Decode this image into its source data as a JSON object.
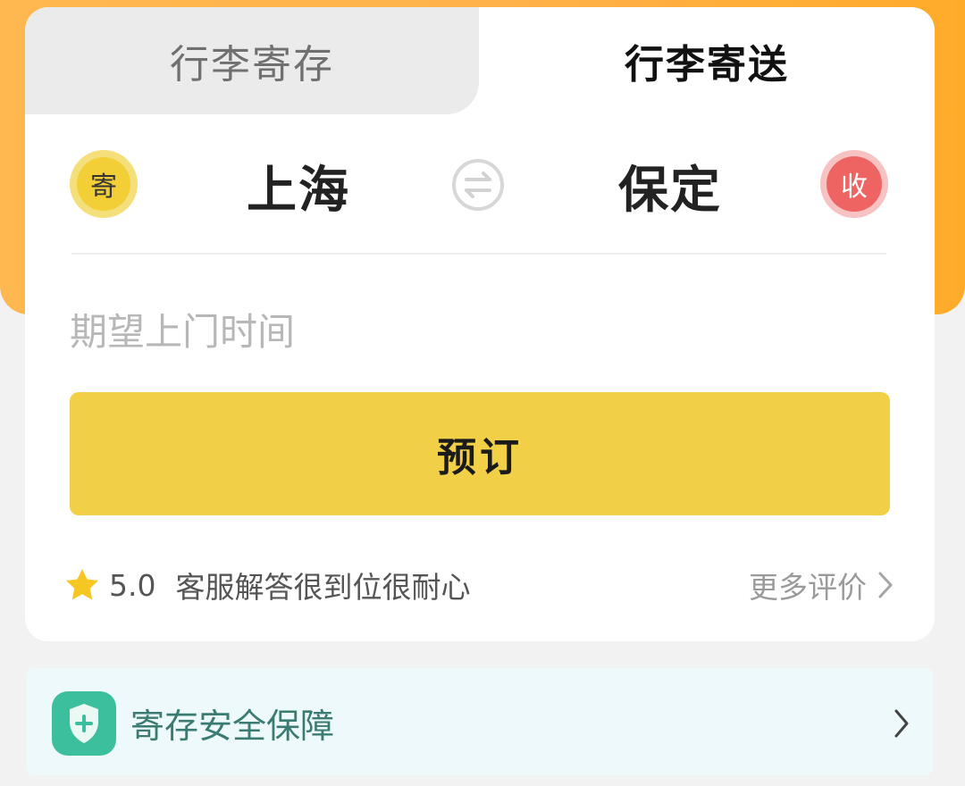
{
  "tabs": [
    {
      "label": "行李寄存",
      "active": false
    },
    {
      "label": "行李寄送",
      "active": true
    }
  ],
  "route": {
    "sender_badge": "寄",
    "from_city": "上海",
    "swap_icon": "swap-arrows-icon",
    "to_city": "保定",
    "receiver_badge": "收"
  },
  "time_field": {
    "placeholder": "期望上门时间"
  },
  "book_button": {
    "label": "预订"
  },
  "review": {
    "rating": "5.0",
    "text": "客服解答很到位很耐心",
    "more_label": "更多评价"
  },
  "security": {
    "label": "寄存安全保障"
  },
  "colors": {
    "accent_orange": "#ffb24a",
    "button_yellow": "#f1d047",
    "sender_yellow": "#f2cf36",
    "receiver_red": "#ee6462",
    "shield_green": "#3bbf9c",
    "star_yellow": "#f6c623"
  }
}
